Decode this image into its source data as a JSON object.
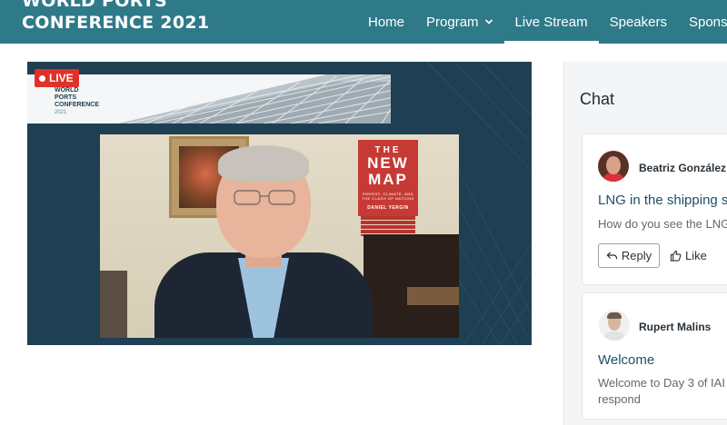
{
  "header": {
    "logo_line1": "WORLD PORTS",
    "logo_line2": "CONFERENCE 2021",
    "nav": [
      {
        "label": "Home",
        "active": false
      },
      {
        "label": "Program",
        "active": false,
        "has_dropdown": true
      },
      {
        "label": "Live Stream",
        "active": true
      },
      {
        "label": "Speakers",
        "active": false
      },
      {
        "label": "Spons",
        "active": false
      }
    ]
  },
  "video": {
    "live_label": "LIVE",
    "banner_logo_line1": "WORLD",
    "banner_logo_line2": "PORTS",
    "banner_logo_line3": "CONFERENCE",
    "banner_logo_year": "2021",
    "book_line1": "THE",
    "book_line2": "NEW",
    "book_line3": "MAP",
    "book_subtitle": "ENERGY, CLIMATE, AND THE CLASH OF NATIONS",
    "book_author": "DANIEL YERGIN"
  },
  "chat": {
    "title": "Chat",
    "messages": [
      {
        "author": "Beatriz González",
        "title": "LNG in the shipping s",
        "body_lines": [
          "How do you see the LNG"
        ],
        "reply_label": "Reply",
        "like_label": "Like"
      },
      {
        "author": "Rupert Malins",
        "title": "Welcome",
        "body_lines": [
          "Welcome to Day 3 of IAI",
          "respond"
        ]
      }
    ]
  },
  "colors": {
    "header_bg": "#2f7a88",
    "live_red": "#e0312a",
    "video_bg": "#1f3f53",
    "msg_title": "#1f4f68"
  },
  "icons": {
    "nav_dropdown": "chevron-down-icon",
    "reply": "reply-arrow-icon",
    "like": "thumbs-up-icon"
  }
}
